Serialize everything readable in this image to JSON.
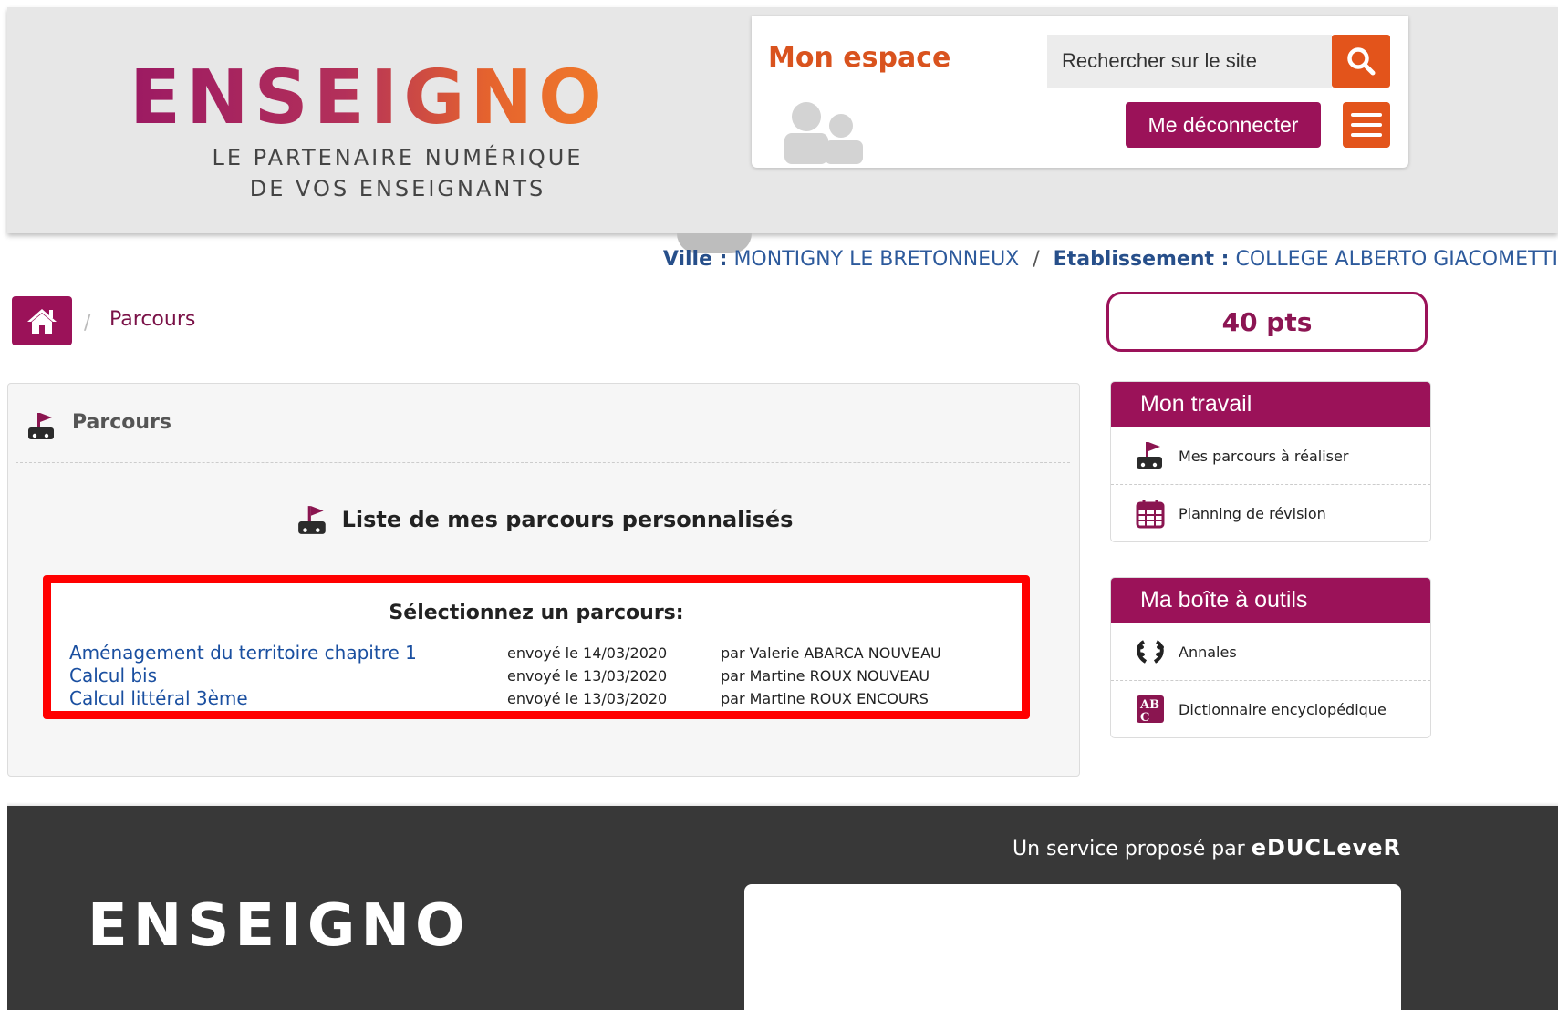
{
  "header": {
    "logo": "ENSEIGNO",
    "tagline_line1": "LE PARTENAIRE NUMÉRIQUE",
    "tagline_line2": "DE VOS ENSEIGNANTS",
    "space_title": "Mon espace",
    "search_placeholder": "Rechercher sur le site",
    "logout_label": "Me déconnecter",
    "search_icon": "search-icon",
    "menu_icon": "hamburger-icon"
  },
  "location": {
    "city_label": "Ville :",
    "city": "MONTIGNY LE BRETONNEUX",
    "separator": "/",
    "school_label": "Etablissement :",
    "school": "COLLEGE ALBERTO GIACOMETTI"
  },
  "breadcrumb": {
    "separator": "/",
    "current": "Parcours"
  },
  "points": "40 pts",
  "panel": {
    "heading": "Parcours",
    "list_title": "Liste de mes parcours personnalisés",
    "select_title": "Sélectionnez un parcours:",
    "rows": [
      {
        "name": "Aménagement du territoire chapitre 1",
        "date": "envoyé le 14/03/2020",
        "by": "par Valerie ABARCA NOUVEAU"
      },
      {
        "name": "Calcul bis",
        "date": "envoyé le 13/03/2020",
        "by": "par Martine ROUX NOUVEAU"
      },
      {
        "name": "Calcul littéral 3ème",
        "date": "envoyé le 13/03/2020",
        "by": "par Martine ROUX ENCOURS"
      }
    ]
  },
  "sidebar": {
    "work": {
      "title": "Mon travail",
      "items": [
        {
          "label": "Mes parcours à réaliser",
          "icon": "path-icon"
        },
        {
          "label": "Planning de révision",
          "icon": "calendar-icon"
        }
      ]
    },
    "tools": {
      "title": "Ma boîte à outils",
      "items": [
        {
          "label": "Annales",
          "icon": "laurel-icon"
        },
        {
          "label": "Dictionnaire encyclopédique",
          "icon": "dictionary-icon"
        }
      ]
    }
  },
  "footer": {
    "service_prefix": "Un service proposé par",
    "service_brand": "eDUCLeveR",
    "logo": "ENSEIGNO"
  },
  "colors": {
    "brand_purple": "#9b1259",
    "brand_orange": "#e3541b",
    "highlight_red": "#ff0000"
  }
}
